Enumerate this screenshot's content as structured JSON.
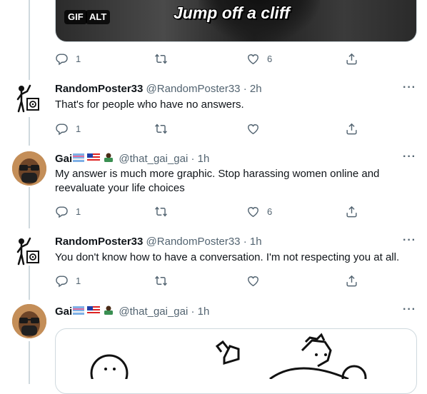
{
  "media_top": {
    "badge_gif": "GIF",
    "badge_alt": "ALT",
    "caption": "Jump off a cliff",
    "reply_count": "1",
    "like_count": "6"
  },
  "tweets": [
    {
      "display_name": "RandomPoster33",
      "handle": "@RandomPoster33",
      "time": "· 2h",
      "text": "That's for people who have no answers.",
      "reply_count": "1",
      "like_count": ""
    },
    {
      "display_name": "Gai",
      "handle": "@that_gai_gai",
      "time": "· 1h",
      "text": "My answer is much more graphic. Stop harassing women online and reevaluate your life choices",
      "reply_count": "1",
      "like_count": "6"
    },
    {
      "display_name": "RandomPoster33",
      "handle": "@RandomPoster33",
      "time": "· 1h",
      "text": "You don't know how to have a conversation. I'm not respecting you at all.",
      "reply_count": "1",
      "like_count": ""
    },
    {
      "display_name": "Gai",
      "handle": "@that_gai_gai",
      "time": "· 1h"
    }
  ],
  "more_label": "···",
  "icons": {
    "reply": "reply-icon",
    "retweet": "retweet-icon",
    "like": "heart-icon",
    "share": "share-icon",
    "more": "more-icon"
  },
  "colors": {
    "text": "#0f1419",
    "secondary": "#536471",
    "border": "#cfd9de"
  }
}
